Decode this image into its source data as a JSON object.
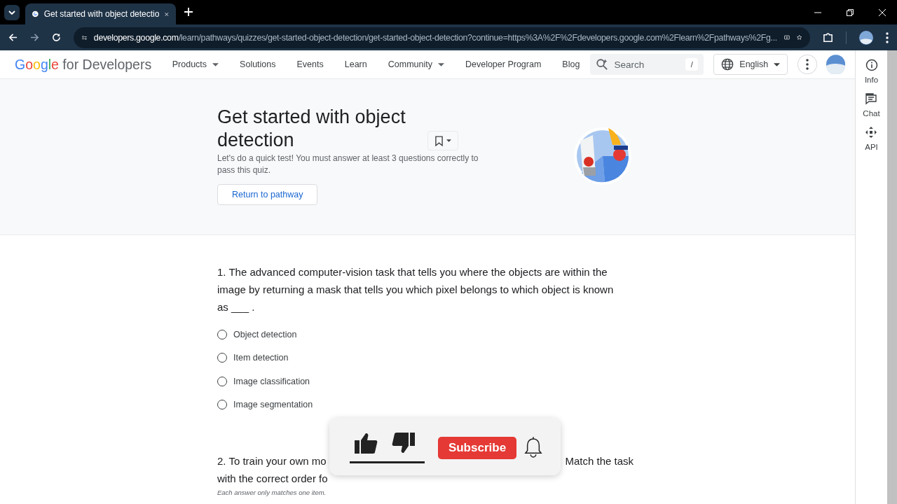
{
  "browser": {
    "tabs": [
      {
        "title": "Get started with object detectio",
        "selected": true
      }
    ],
    "url": {
      "host": "developers.google.com",
      "path": "/learn/pathways/quizzes/get-started-object-detection/get-started-object-detection?continue=https%3A%2F%2Fdevelopers.google.com%2Flearn%2Fpathways%2Fg..."
    }
  },
  "header": {
    "logo": {
      "brand": "Google",
      "suffix": "for Developers"
    },
    "nav": [
      {
        "label": "Products",
        "dropdown": true
      },
      {
        "label": "Solutions",
        "dropdown": false
      },
      {
        "label": "Events",
        "dropdown": false
      },
      {
        "label": "Learn",
        "dropdown": false
      },
      {
        "label": "Community",
        "dropdown": true
      },
      {
        "label": "Developer Program",
        "dropdown": false
      },
      {
        "label": "Blog",
        "dropdown": false
      }
    ],
    "search": {
      "placeholder": "Search",
      "shortcut": "/"
    },
    "language": "English"
  },
  "hero": {
    "title": "Get started with object detection",
    "description": "Let's do a quick test! You must answer at least 3 questions correctly to pass this quiz.",
    "button": "Return to pathway"
  },
  "side_panel": [
    {
      "label": "Info",
      "kind": "info"
    },
    {
      "label": "Chat",
      "kind": "chat"
    },
    {
      "label": "API",
      "kind": "api"
    }
  ],
  "questions": [
    {
      "text": "1. The advanced computer-vision task that tells you where the objects are within the image by returning a mask that tells you which pixel belongs to which object is known as ___ .",
      "options": [
        {
          "label": "Object detection",
          "selected": false
        },
        {
          "label": "Item detection",
          "selected": false
        },
        {
          "label": "Image classification",
          "selected": false
        },
        {
          "label": "Image segmentation",
          "selected": false
        }
      ]
    }
  ],
  "question_2": {
    "line_1_start": "2. To train your own mo",
    "line_1_end": "Match the task",
    "line_2": "with the correct order fo",
    "hint": "Each answer only matches one item."
  },
  "overlay": {
    "subscribe": "Subscribe"
  }
}
